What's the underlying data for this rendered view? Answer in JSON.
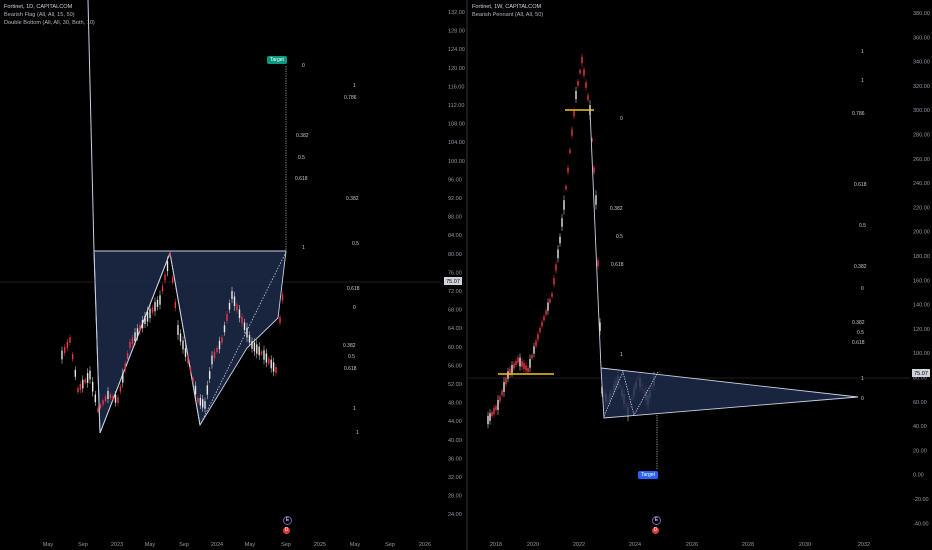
{
  "left": {
    "legend": {
      "title": "Fortinet, 1D, CAPITALCOM",
      "lines": [
        "Bearish Flag (All, All, 15, 50)",
        "Double Bottom (All, All, 30, Both, 10)"
      ]
    },
    "y_ticks": [
      "132.00",
      "128.00",
      "124.00",
      "120.00",
      "116.00",
      "112.00",
      "108.00",
      "104.00",
      "100.00",
      "96.00",
      "92.00",
      "88.00",
      "84.00",
      "80.00",
      "76.00",
      "72.00",
      "68.00",
      "64.00",
      "60.00",
      "56.00",
      "52.00",
      "48.00",
      "44.00",
      "40.00",
      "36.00",
      "32.00",
      "28.00",
      "24.00"
    ],
    "x_ticks": [
      "May",
      "Sep",
      "2023",
      "May",
      "Sep",
      "2024",
      "May",
      "Sep",
      "2025",
      "May",
      "Sep",
      "2026"
    ],
    "last_price": "75.07",
    "target_label": "Target",
    "fib_levels": [
      "0",
      "1",
      "0.786",
      "0.382",
      "0.5",
      "0.618",
      "0.382",
      "1",
      "0.5",
      "0.618",
      "0",
      "0.382",
      "0.5",
      "0.618",
      "1",
      "1"
    ],
    "event_labels": [
      "E",
      "D"
    ],
    "colors": {
      "accent_green": "#089981",
      "pattern_fill": "#1d2b4a",
      "pattern_line": "#c9d0e3"
    }
  },
  "right": {
    "legend": {
      "title": "Fortinet, 1W, CAPITALCOM",
      "lines": [
        "Bearish Pennant (All, All, 50)"
      ]
    },
    "y_ticks": [
      "380.00",
      "360.00",
      "340.00",
      "320.00",
      "300.00",
      "280.00",
      "260.00",
      "240.00",
      "220.00",
      "200.00",
      "180.00",
      "160.00",
      "140.00",
      "120.00",
      "100.00",
      "80.00",
      "60.00",
      "40.00",
      "20.00",
      "0.00",
      "-20.00",
      "-40.00"
    ],
    "x_ticks": [
      "2018",
      "2020",
      "2022",
      "2024",
      "2026",
      "2028",
      "2030",
      "2032"
    ],
    "last_price": "75.07",
    "target_label": "Target",
    "fib_levels": [
      "1",
      "1",
      "0.786",
      "0",
      "0.382",
      "0.5",
      "0.618",
      "0.618",
      "0.5",
      "0.382",
      "0",
      "0.382",
      "0.5",
      "0.618",
      "1",
      "1",
      "0"
    ],
    "event_labels": [
      "E",
      "D"
    ],
    "colors": {
      "accent_blue": "#2962ff",
      "pattern_fill": "#1d2b4a",
      "level_yellow": "#f5c518"
    }
  }
}
